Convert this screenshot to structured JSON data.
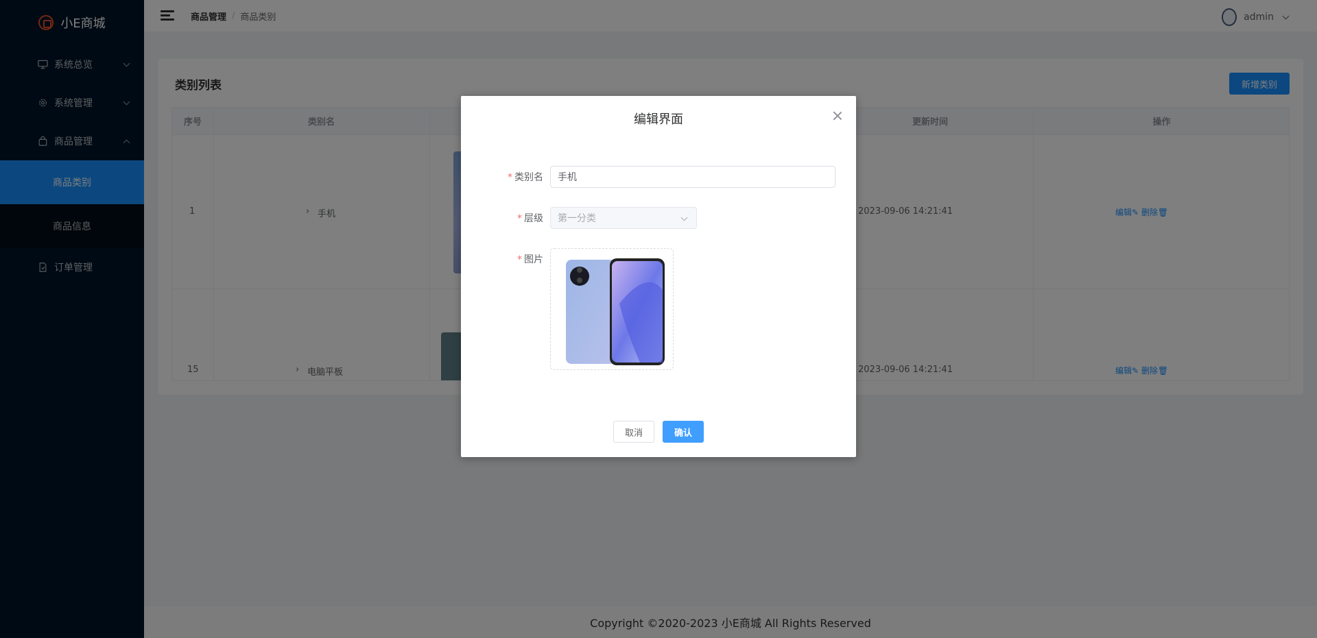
{
  "app": {
    "title": "小E商城"
  },
  "sidebar": {
    "items": [
      {
        "label": "系统总览",
        "icon": "monitor-icon"
      },
      {
        "label": "系统管理",
        "icon": "gear-icon"
      },
      {
        "label": "商品管理",
        "icon": "bag-icon"
      },
      {
        "label": "订单管理",
        "icon": "document-icon"
      }
    ],
    "sub_items": [
      {
        "label": "商品类别",
        "active": true
      },
      {
        "label": "商品信息",
        "active": false
      }
    ]
  },
  "header": {
    "breadcrumb": [
      "商品管理",
      "商品类别"
    ],
    "breadcrumb_sep": "/",
    "username": "admin"
  },
  "main": {
    "title": "类别列表",
    "add_button": "新增类别",
    "table": {
      "columns": [
        "序号",
        "类别名",
        "更新时间",
        "操作"
      ],
      "rows": [
        {
          "index": "1",
          "name": "手机",
          "updated": "2023-09-06 14:21:41",
          "edit": "编辑",
          "delete": "删除"
        },
        {
          "index": "15",
          "name": "电脑平板",
          "updated": "2023-09-06 14:21:41",
          "edit": "编辑",
          "delete": "删除"
        }
      ]
    }
  },
  "dialog": {
    "title": "编辑界面",
    "fields": {
      "name_label": "类别名",
      "name_value": "手机",
      "level_label": "层级",
      "level_value": "第一分类",
      "image_label": "图片"
    },
    "cancel": "取消",
    "confirm": "确认"
  },
  "footer": {
    "text": "Copyright ©2020-2023 小E商城 All Rights Reserved"
  },
  "colors": {
    "primary": "#1890ff",
    "sidebar": "#001529",
    "logo": "#e8502a",
    "required": "#f56c6c"
  }
}
